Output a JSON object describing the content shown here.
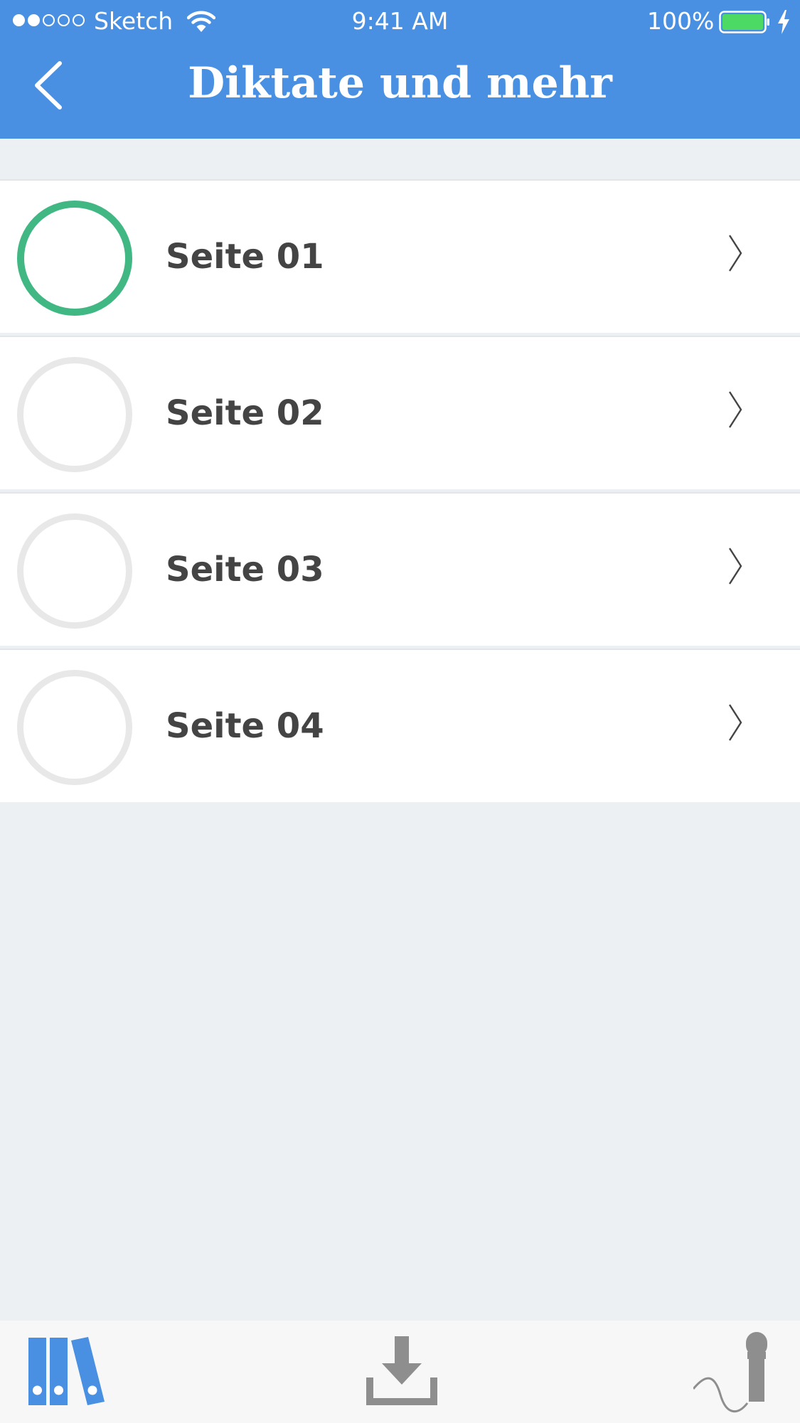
{
  "status_bar": {
    "carrier": "Sketch",
    "time": "9:41 AM",
    "battery_percent": "100%",
    "signal_bars_filled": 2,
    "signal_bars_total": 5
  },
  "nav": {
    "title": "Diktate und mehr",
    "back_icon": "chevron-left-icon"
  },
  "list": {
    "items": [
      {
        "label": "Seite 01",
        "status": "completed",
        "ring_color": "#41B883"
      },
      {
        "label": "Seite 02",
        "status": "not-started",
        "ring_color": "#E8E8E8"
      },
      {
        "label": "Seite 03",
        "status": "not-started",
        "ring_color": "#E8E8E8"
      },
      {
        "label": "Seite 04",
        "status": "not-started",
        "ring_color": "#E8E8E8"
      }
    ]
  },
  "tab_bar": {
    "tabs": [
      {
        "name": "library",
        "icon": "books-icon",
        "active": true
      },
      {
        "name": "download",
        "icon": "download-icon",
        "active": false
      },
      {
        "name": "dictate",
        "icon": "microphone-icon",
        "active": false
      }
    ]
  },
  "colors": {
    "accent": "#4A90E2",
    "completed": "#41B883",
    "inactive_ring": "#E8E8E8",
    "inactive_icon": "#8E8E8E",
    "background": "#ECF0F3"
  }
}
